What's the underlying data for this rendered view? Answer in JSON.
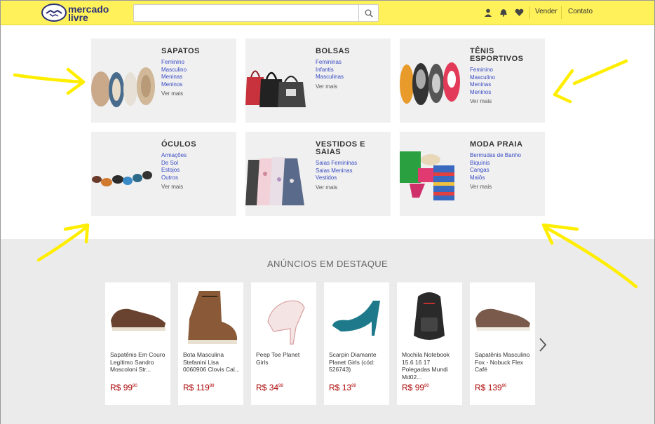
{
  "header": {
    "logo_line1": "mercado",
    "logo_line2": "livre",
    "search_placeholder": "",
    "links": [
      "Vender",
      "Contato"
    ]
  },
  "categories": [
    {
      "title": "SAPATOS",
      "links": [
        "Feminino",
        "Masculino",
        "Meninas",
        "Meninos"
      ],
      "more": "Ver mais"
    },
    {
      "title": "BOLSAS",
      "links": [
        "Femininas",
        "Infantis",
        "Masculinas"
      ],
      "more": "Ver mais"
    },
    {
      "title": "TÊNIS ESPORTIVOS",
      "links": [
        "Feminino",
        "Masculino",
        "Meninas",
        "Meninos"
      ],
      "more": "Ver mais"
    },
    {
      "title": "ÓCULOS",
      "links": [
        "Armações",
        "De Sol",
        "Estojos",
        "Outros"
      ],
      "more": "Ver mais"
    },
    {
      "title": "VESTIDOS E SAIAS",
      "links": [
        "Saias Femininas",
        "Saias Meninas",
        "Vestidos"
      ],
      "more": "Ver mais"
    },
    {
      "title": "MODA PRAIA",
      "links": [
        "Bermudas de Banho",
        "Biquínis",
        "Cangas",
        "Maiôs"
      ],
      "more": "Ver mais"
    }
  ],
  "featured": {
    "title": "ANÚNCIOS EM DESTAQUE",
    "products": [
      {
        "name": "Sapatênis Em Couro Legítimo Sandro Moscoloni Str...",
        "currency": "R$",
        "price": "99",
        "cents": "90"
      },
      {
        "name": "Bota Masculina Stefanini Lisa 0060906 Clovis Cal...",
        "currency": "R$",
        "price": "119",
        "cents": "99"
      },
      {
        "name": "Peep Toe Planet Girls",
        "currency": "R$",
        "price": "34",
        "cents": "99"
      },
      {
        "name": "Scarpin Diamante Planet Girls (cód: 526743)",
        "currency": "R$",
        "price": "13",
        "cents": "99"
      },
      {
        "name": "Mochila Notebook 15.6 16 17 Polegadas Mundi Md02...",
        "currency": "R$",
        "price": "99",
        "cents": "90"
      },
      {
        "name": "Sapatênis Masculino Fox - Nobuck Flex Café",
        "currency": "R$",
        "price": "139",
        "cents": "90"
      }
    ]
  },
  "colors": {
    "header_bg": "#fff159",
    "link": "#3a4cc4",
    "price": "#aa0000",
    "annotation": "#ffee00"
  }
}
